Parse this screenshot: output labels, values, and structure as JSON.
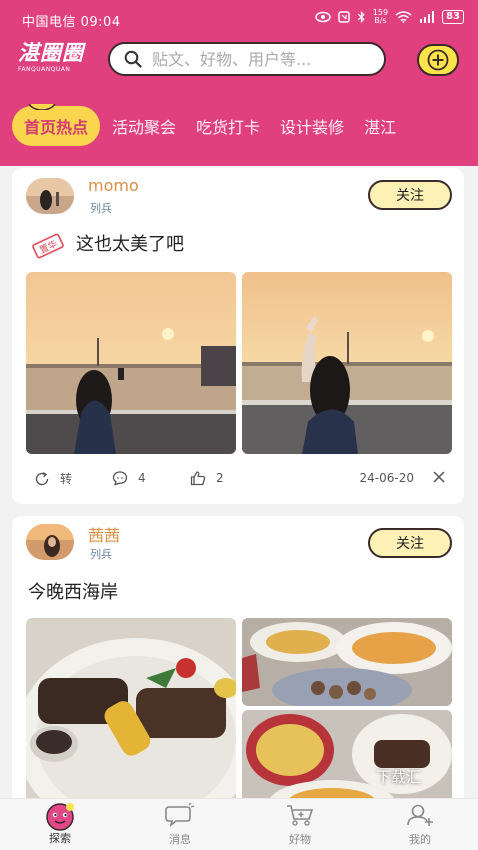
{
  "status_bar": {
    "carrier_time": "中国电信 09:04",
    "net_speed_value": "159",
    "net_speed_unit": "B/s",
    "battery": "83"
  },
  "logo": {
    "cn": "湛圈圈",
    "en": "FANQUANQUAN"
  },
  "search": {
    "placeholder": "贴文、好物、用户等..."
  },
  "tabs": [
    {
      "label": "首页热点",
      "active": true
    },
    {
      "label": "活动聚会"
    },
    {
      "label": "吃货打卡"
    },
    {
      "label": "设计装修"
    },
    {
      "label": "湛江"
    }
  ],
  "posts": [
    {
      "username": "momo",
      "subtitle": "列兵",
      "follow_label": "关注",
      "stamp_text": "置华",
      "text": "这也太美了吧",
      "repost_label": "转",
      "comments": "4",
      "likes": "2",
      "date": "24-06-20"
    },
    {
      "username": "茜茜",
      "subtitle": "列兵",
      "follow_label": "关注",
      "text": "今晚西海岸"
    }
  ],
  "watermark": "下载汇",
  "bottom_nav": [
    {
      "label": "探索",
      "icon": "explore-face-icon",
      "active": true
    },
    {
      "label": "消息",
      "icon": "message-icon"
    },
    {
      "label": "好物",
      "icon": "cart-icon"
    },
    {
      "label": "我的",
      "icon": "profile-icon"
    }
  ],
  "colors": {
    "brand_pink": "#e0417e",
    "accent_yellow": "#fde34a",
    "username_orange": "#d99043",
    "rank_blue": "#6b86a8"
  }
}
